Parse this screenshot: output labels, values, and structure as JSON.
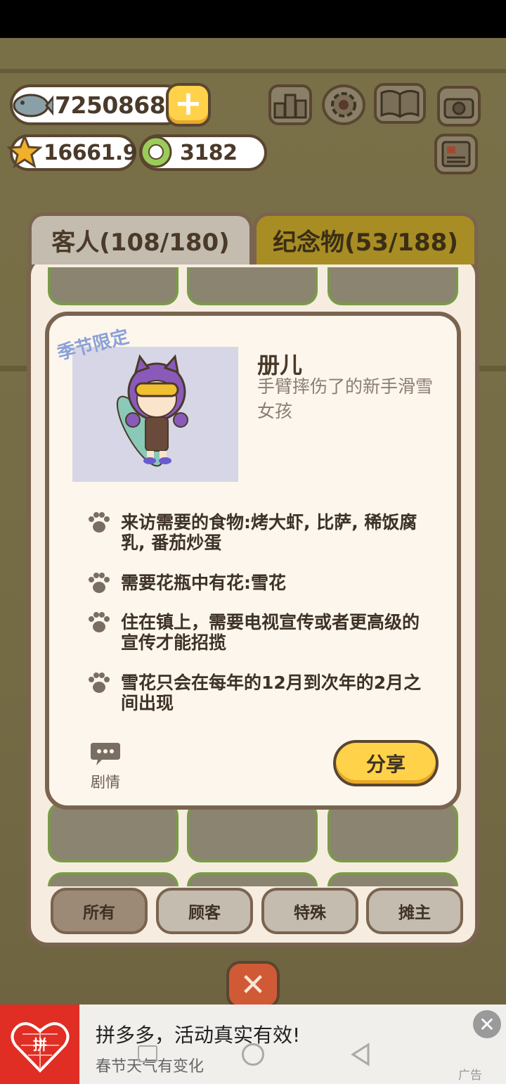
{
  "currency": {
    "fish_amount": "7250868",
    "star_amount": "16661.9",
    "clover_amount": "3182",
    "add_label": "+"
  },
  "tabs": {
    "guests": "客人(108/180)",
    "souvenirs": "纪念物(53/188)"
  },
  "detail": {
    "season_tag": "季节限定",
    "name": "册儿",
    "description": "手臂摔伤了的新手滑雪女孩",
    "requirements": [
      "来访需要的食物:烤大虾, 比萨, 稀饭腐乳, 番茄炒蛋",
      "需要花瓶中有花:雪花",
      "住在镇上，需要电视宣传或者更高级的宣传才能招揽",
      "雪花只会在每年的12月到次年的2月之间出现"
    ],
    "story_label": "剧情",
    "share_label": "分享"
  },
  "filters": [
    "所有",
    "顾客",
    "特殊",
    "摊主"
  ],
  "ad": {
    "logo_text": "拼",
    "title": "拼多多，活动真实有效!",
    "subtitle": "春节天气有变化",
    "tag": "广告"
  },
  "colors": {
    "panel_bg": "#f6ede0",
    "accent_yellow": "#ffd24a",
    "border_brown": "#7a6450",
    "tab_inactive": "#a88c24"
  }
}
